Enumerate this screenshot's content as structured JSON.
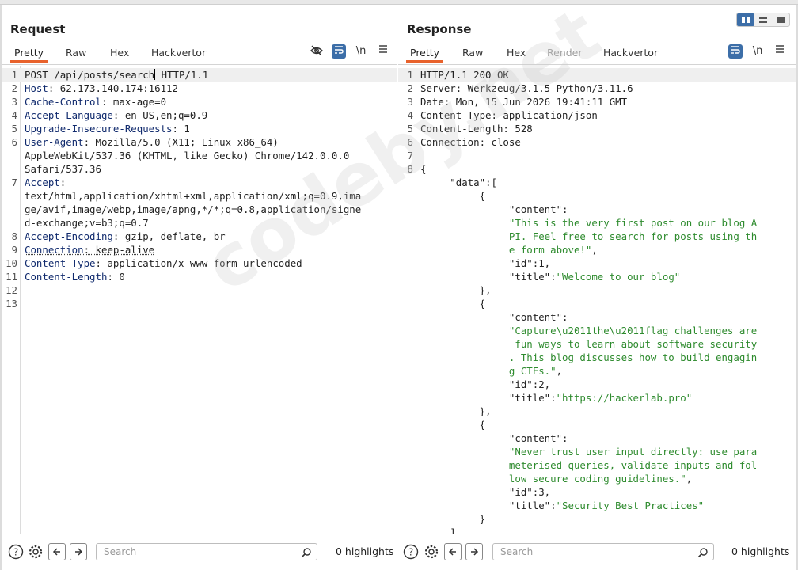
{
  "request": {
    "title": "Request",
    "tabs": [
      "Pretty",
      "Raw",
      "Hex",
      "Hackvertor"
    ],
    "active_tab": "Pretty",
    "toolbar_icons": [
      "eye-slash-icon",
      "wrap-icon",
      "newline-icon",
      "menu-icon"
    ],
    "newline_label": "\\n",
    "lines": [
      {
        "n": "1",
        "k": "POST /api/posts/search",
        "v": " HTTP/1.1"
      },
      {
        "n": "2",
        "k": "Host",
        "v": ": 62.173.140.174:16112"
      },
      {
        "n": "3",
        "k": "Cache-Control",
        "v": ": max-age=0"
      },
      {
        "n": "4",
        "k": "Accept-Language",
        "v": ": en-US,en;q=0.9"
      },
      {
        "n": "5",
        "k": "Upgrade-Insecure-Requests",
        "v": ": 1"
      },
      {
        "n": "6",
        "k": "User-Agent",
        "v": ": Mozilla/5.0 (X11; Linux x86_64)"
      },
      {
        "n": "",
        "k": "",
        "v": "AppleWebKit/537.36 (KHTML, like Gecko) Chrome/142.0.0.0"
      },
      {
        "n": "",
        "k": "",
        "v": "Safari/537.36"
      },
      {
        "n": "7",
        "k": "Accept",
        "v": ":"
      },
      {
        "n": "",
        "k": "",
        "v": "text/html,application/xhtml+xml,application/xml;q=0.9,ima"
      },
      {
        "n": "",
        "k": "",
        "v": "ge/avif,image/webp,image/apng,*/*;q=0.8,application/signe"
      },
      {
        "n": "",
        "k": "",
        "v": "d-exchange;v=b3;q=0.7"
      },
      {
        "n": "8",
        "k": "Accept-Encoding",
        "v": ": gzip, deflate, br"
      },
      {
        "n": "9",
        "k": "Connection",
        "v": ": keep-alive"
      },
      {
        "n": "10",
        "k": "Content-Type",
        "v": ": application/x-www-form-urlencoded"
      },
      {
        "n": "11",
        "k": "Content-Length",
        "v": ": 0"
      },
      {
        "n": "12",
        "k": "",
        "v": ""
      },
      {
        "n": "13",
        "k": "",
        "v": ""
      }
    ],
    "search_placeholder": "Search",
    "highlights": "0 highlights"
  },
  "response": {
    "title": "Response",
    "tabs": [
      "Pretty",
      "Raw",
      "Hex",
      "Render",
      "Hackvertor"
    ],
    "active_tab": "Pretty",
    "disabled_tab": "Render",
    "toolbar_icons": [
      "wrap-icon",
      "newline-icon",
      "menu-icon"
    ],
    "newline_label": "\\n",
    "lines": [
      {
        "n": "1",
        "t": "HTTP/1.1 200 OK"
      },
      {
        "n": "2",
        "t": "Server: Werkzeug/3.1.5 Python/3.11.6"
      },
      {
        "n": "3",
        "t": "Date: Mon, 15 Jun 2026 19:41:11 GMT"
      },
      {
        "n": "4",
        "t": "Content-Type: application/json"
      },
      {
        "n": "5",
        "t": "Content-Length: 528"
      },
      {
        "n": "6",
        "t": "Connection: close"
      },
      {
        "n": "7",
        "t": ""
      },
      {
        "n": "8",
        "t": "{"
      },
      {
        "n": "",
        "t": "     \"data\":["
      },
      {
        "n": "",
        "t": "          {"
      },
      {
        "n": "",
        "t": "               \"content\":"
      },
      {
        "n": "",
        "s": "               \"This is the very first post on our blog A"
      },
      {
        "n": "",
        "s": "               PI. Feel free to search for posts using th"
      },
      {
        "n": "",
        "s": "               e form above!\"",
        "p": ","
      },
      {
        "n": "",
        "t": "               \"id\":1,"
      },
      {
        "n": "",
        "t": "               \"title\":",
        "s2": "\"Welcome to our blog\""
      },
      {
        "n": "",
        "t": "          },"
      },
      {
        "n": "",
        "t": "          {"
      },
      {
        "n": "",
        "t": "               \"content\":"
      },
      {
        "n": "",
        "s": "               \"Capture\\u2011the\\u2011flag challenges are"
      },
      {
        "n": "",
        "s": "                fun ways to learn about software security"
      },
      {
        "n": "",
        "s": "               . This blog discusses how to build engagin"
      },
      {
        "n": "",
        "s": "               g CTFs.\"",
        "p": ","
      },
      {
        "n": "",
        "t": "               \"id\":2,"
      },
      {
        "n": "",
        "t": "               \"title\":",
        "s2": "\"https://hackerlab.pro\""
      },
      {
        "n": "",
        "t": "          },"
      },
      {
        "n": "",
        "t": "          {"
      },
      {
        "n": "",
        "t": "               \"content\":"
      },
      {
        "n": "",
        "s": "               \"Never trust user input directly: use para"
      },
      {
        "n": "",
        "s": "               meterised queries, validate inputs and fol"
      },
      {
        "n": "",
        "s": "               low secure coding guidelines.\"",
        "p": ","
      },
      {
        "n": "",
        "t": "               \"id\":3,"
      },
      {
        "n": "",
        "t": "               \"title\":",
        "s2": "\"Security Best Practices\""
      },
      {
        "n": "",
        "t": "          }"
      },
      {
        "n": "",
        "t": "     ],"
      }
    ],
    "search_placeholder": "Search",
    "highlights": "0 highlights"
  },
  "watermark": "codeby.net",
  "colors": {
    "accent": "#e8622c",
    "blue_button": "#3c6ea8",
    "string_green": "#2e8b2e",
    "header_key": "#102a6d"
  }
}
